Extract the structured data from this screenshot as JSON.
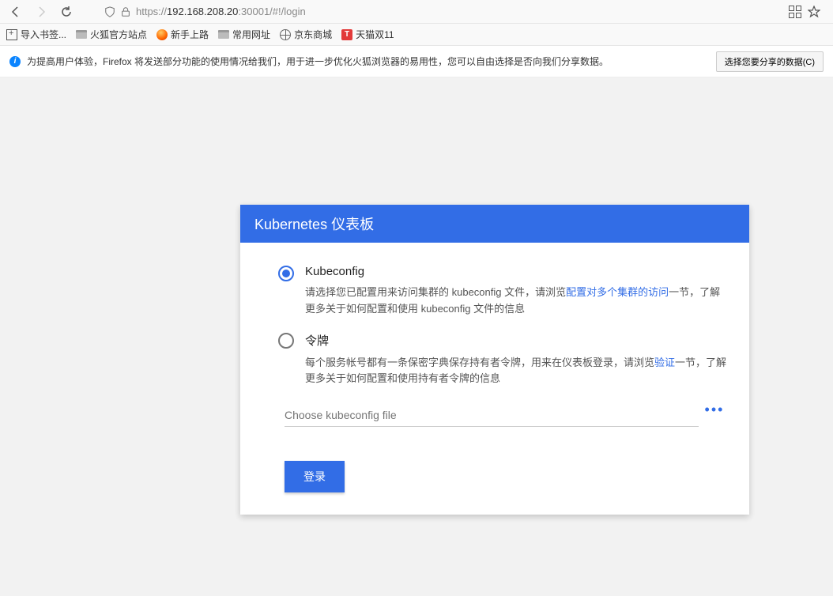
{
  "browser": {
    "url_prefix": "https://",
    "url_host": "192.168.208.20",
    "url_rest": ":30001/#!/login"
  },
  "bookmarks": {
    "import": "导入书签...",
    "firefox_official": "火狐官方站点",
    "getting_started": "新手上路",
    "common_sites": "常用网址",
    "jd": "京东商城",
    "tmall": "天猫双11"
  },
  "infobar": {
    "text": "为提高用户体验，Firefox 将发送部分功能的使用情况给我们，用于进一步优化火狐浏览器的易用性，您可以自由选择是否向我们分享数据。",
    "button": "选择您要分享的数据(C)"
  },
  "login": {
    "header": "Kubernetes 仪表板",
    "kubeconfig": {
      "title": "Kubeconfig",
      "desc_pre": "请选择您已配置用来访问集群的 kubeconfig 文件，请浏览",
      "desc_link": "配置对多个集群的访问",
      "desc_post": "一节，了解更多关于如何配置和使用 kubeconfig 文件的信息"
    },
    "token": {
      "title": "令牌",
      "desc_pre": "每个服务帐号都有一条保密字典保存持有者令牌，用来在仪表板登录，请浏览",
      "desc_link": "验证",
      "desc_post": "一节，了解更多关于如何配置和使用持有者令牌的信息"
    },
    "file_placeholder": "Choose kubeconfig file",
    "submit": "登录"
  }
}
